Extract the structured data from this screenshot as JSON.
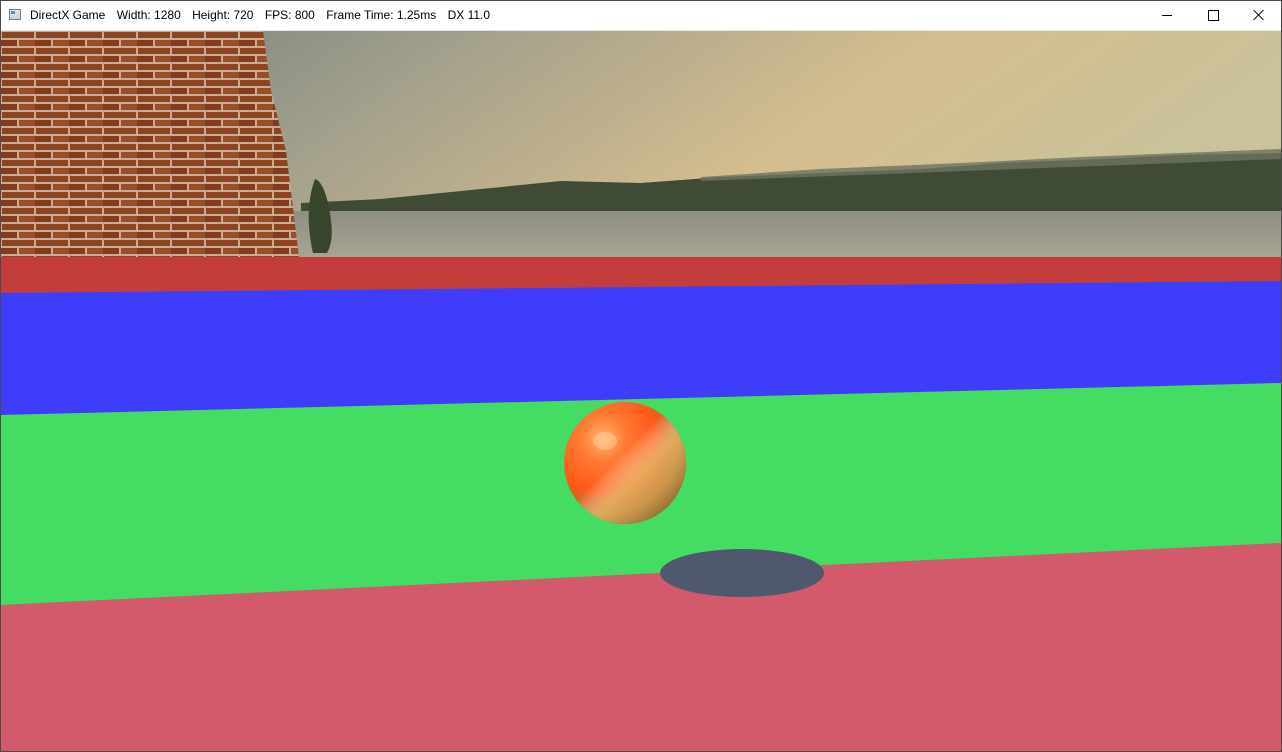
{
  "window": {
    "title_parts": {
      "app": "DirectX Game",
      "width": "Width: 1280",
      "height": "Height: 720",
      "fps": "FPS: 800",
      "frame_time": "Frame Time: 1.25ms",
      "dx": "DX 11.0"
    },
    "icon": "application-icon",
    "controls": [
      "minimize-icon",
      "maximize-icon",
      "close-icon"
    ]
  },
  "scene": {
    "sky_colors": [
      "#7d8a86",
      "#a7a58e",
      "#d7c18d",
      "#b8b28c"
    ],
    "water_color": "#9a9a88",
    "brick_color": "#8a4522",
    "tree_line_color": "#3f4a33",
    "stripe_colors": {
      "red_far": "#c43d3d",
      "blue": "#3d3dfb",
      "green": "#45dc63",
      "red_near": "#d35a6b"
    },
    "ball_colors": [
      "#ff9a55",
      "#ff5a1e",
      "#d9a64c",
      "#5a3410"
    ],
    "shadow_color": "#4f586d"
  }
}
